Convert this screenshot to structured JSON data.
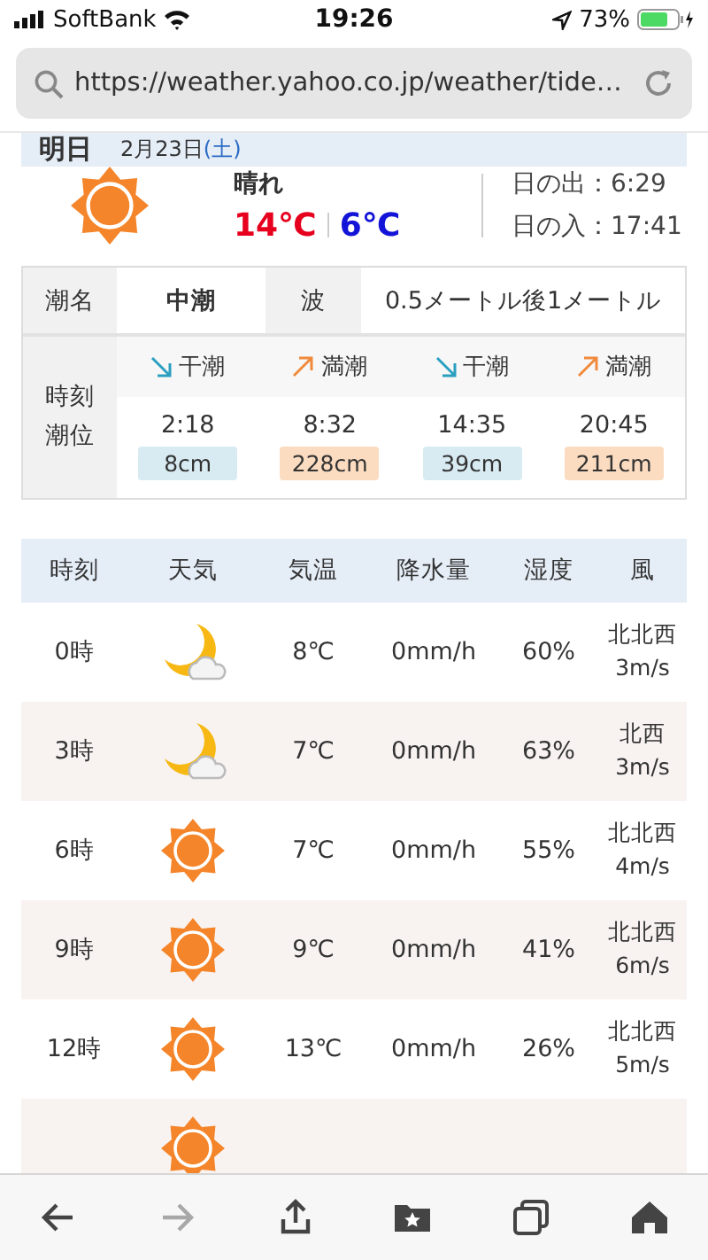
{
  "status_bar": {
    "carrier": "SoftBank",
    "time": "19:26",
    "battery": "73%"
  },
  "address_bar": {
    "url": "https://weather.yahoo.co.jp/weather/tide…"
  },
  "day_header": {
    "label": "明日",
    "date": "2月23日",
    "weekday": "(土)"
  },
  "summary": {
    "kind": "sunny",
    "condition": "晴れ",
    "high": "14℃",
    "low": "6℃",
    "sunrise": "日の出：6:29",
    "sunset": "日の入：17:41"
  },
  "tide": {
    "name_label": "潮名",
    "name": "中潮",
    "wave_label": "波",
    "wave": "0.5メートル後1メートル",
    "time_label": [
      "時刻",
      "潮位"
    ],
    "events": [
      {
        "kind": "low",
        "label": "干潮",
        "time": "2:18",
        "level_text": "8cm"
      },
      {
        "kind": "high",
        "label": "満潮",
        "time": "8:32",
        "level_text": "228cm"
      },
      {
        "kind": "low",
        "label": "干潮",
        "time": "14:35",
        "level_text": "39cm"
      },
      {
        "kind": "high",
        "label": "満潮",
        "time": "20:45",
        "level_text": "211cm"
      }
    ]
  },
  "hourly": {
    "columns": [
      "時刻",
      "天気",
      "気温",
      "降水量",
      "湿度",
      "風"
    ],
    "rows": [
      {
        "time": "0時",
        "kind": "moon_cloud",
        "temp": "8℃",
        "precip": "0mm/h",
        "humidity": "60%",
        "wind_dir": "北北西",
        "wind_speed": "3m/s"
      },
      {
        "time": "3時",
        "kind": "moon_cloud",
        "temp": "7℃",
        "precip": "0mm/h",
        "humidity": "63%",
        "wind_dir": "北西",
        "wind_speed": "3m/s"
      },
      {
        "time": "6時",
        "kind": "sunny",
        "temp": "7℃",
        "precip": "0mm/h",
        "humidity": "55%",
        "wind_dir": "北北西",
        "wind_speed": "4m/s"
      },
      {
        "time": "9時",
        "kind": "sunny",
        "temp": "9℃",
        "precip": "0mm/h",
        "humidity": "41%",
        "wind_dir": "北北西",
        "wind_speed": "6m/s"
      },
      {
        "time": "12時",
        "kind": "sunny",
        "temp": "13℃",
        "precip": "0mm/h",
        "humidity": "26%",
        "wind_dir": "北北西",
        "wind_speed": "5m/s"
      },
      {
        "kind": "sunny"
      }
    ]
  },
  "toolbar": [
    {
      "kind": "back",
      "disabled": false
    },
    {
      "kind": "forward",
      "disabled": true
    },
    {
      "kind": "share",
      "disabled": false
    },
    {
      "kind": "bookmarks",
      "disabled": false
    },
    {
      "kind": "tabs",
      "disabled": false
    },
    {
      "kind": "home",
      "disabled": false
    }
  ]
}
